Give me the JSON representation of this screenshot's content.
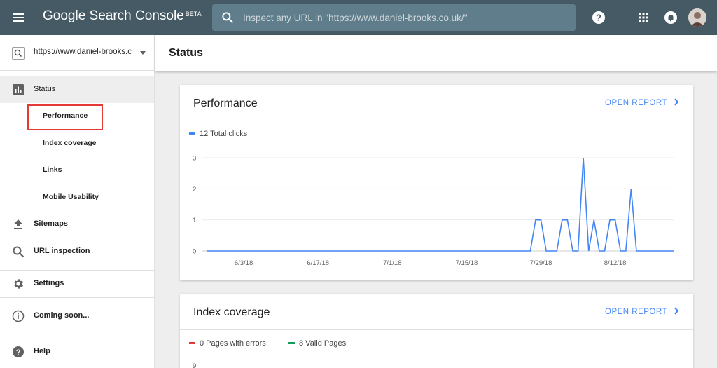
{
  "header": {
    "brand": "Google Search Console",
    "brand_badge": "BETA",
    "search_placeholder": "Inspect any URL in \"https://www.daniel-brooks.co.uk/\"",
    "icons": [
      "menu-icon",
      "search-icon",
      "help-icon",
      "apps-icon",
      "notification-icon",
      "avatar"
    ]
  },
  "sidebar": {
    "property": "https://www.daniel-brooks.co.uk/",
    "property_display": "https://www.daniel-brooks.c...",
    "status_label": "Status",
    "sub_items": [
      {
        "label": "Performance"
      },
      {
        "label": "Index coverage"
      },
      {
        "label": "Links"
      },
      {
        "label": "Mobile Usability"
      }
    ],
    "sitemaps_label": "Sitemaps",
    "url_inspection_label": "URL inspection",
    "settings_label": "Settings",
    "coming_soon_label": "Coming soon...",
    "help_label": "Help"
  },
  "main": {
    "title": "Status",
    "performance": {
      "title": "Performance",
      "open_report": "OPEN REPORT",
      "legend": "12 Total clicks"
    },
    "index_coverage": {
      "title": "Index coverage",
      "open_report": "OPEN REPORT",
      "legend_errors": "0 Pages with errors",
      "legend_valid": "8 Valid Pages",
      "partial_tick": "9"
    }
  },
  "colors": {
    "topbar": "#455a64",
    "search_bg": "#607d8b",
    "accent": "#4285f4",
    "error": "#e53935",
    "valid": "#0f9d58"
  },
  "chart_data": {
    "type": "line",
    "series": [
      {
        "name": "12 Total clicks",
        "values": [
          0,
          0,
          0,
          0,
          0,
          0,
          0,
          0,
          0,
          0,
          0,
          0,
          0,
          0,
          0,
          0,
          0,
          0,
          0,
          0,
          0,
          0,
          0,
          0,
          0,
          0,
          0,
          0,
          0,
          0,
          0,
          0,
          0,
          0,
          0,
          0,
          0,
          0,
          0,
          0,
          0,
          0,
          0,
          0,
          0,
          0,
          0,
          0,
          0,
          0,
          0,
          0,
          0,
          0,
          0,
          0,
          0,
          0,
          0,
          0,
          0,
          0,
          1,
          1,
          0,
          0,
          0,
          1,
          1,
          0,
          0,
          3,
          0,
          1,
          0,
          0,
          1,
          1,
          0,
          0,
          2,
          0,
          0,
          0,
          0,
          0,
          0,
          0,
          0
        ]
      }
    ],
    "x_tick_labels": [
      "6/3/18",
      "6/17/18",
      "7/1/18",
      "7/15/18",
      "7/29/18",
      "8/12/18"
    ],
    "x_tick_index": [
      7,
      21,
      35,
      49,
      63,
      77
    ],
    "y_ticks": [
      0,
      1,
      2,
      3
    ],
    "ylim": [
      0,
      3
    ],
    "grid": true
  }
}
